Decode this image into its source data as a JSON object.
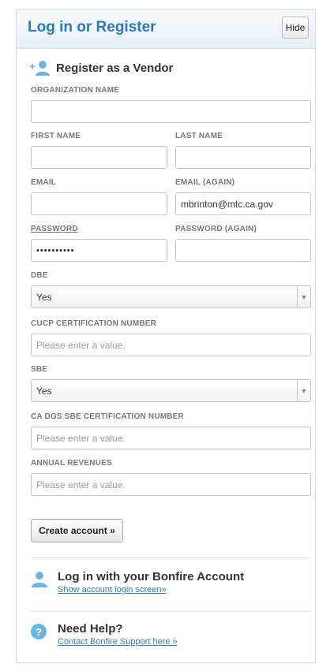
{
  "header": {
    "title": "Log in or Register",
    "hide_label": "Hide"
  },
  "register": {
    "heading": "Register as a Vendor"
  },
  "fields": {
    "org_name": {
      "label": "ORGANIZATION NAME",
      "value": ""
    },
    "first_name": {
      "label": "FIRST NAME",
      "value": ""
    },
    "last_name": {
      "label": "LAST NAME",
      "value": ""
    },
    "email": {
      "label": "EMAIL",
      "value": ""
    },
    "email_again": {
      "label": "EMAIL (AGAIN)",
      "value": "mbrinton@mtc.ca.gov"
    },
    "password": {
      "label": "PASSWORD",
      "value": "••••••••••"
    },
    "password_again": {
      "label": "PASSWORD (AGAIN)",
      "value": ""
    },
    "dbe": {
      "label": "DBE",
      "selected": "Yes"
    },
    "cucp": {
      "label": "CUCP CERTIFICATION NUMBER",
      "placeholder": "Please enter a value."
    },
    "sbe": {
      "label": "SBE",
      "selected": "Yes"
    },
    "ca_dgs": {
      "label": "CA DGS SBE CERTIFICATION NUMBER",
      "placeholder": "Please enter a value."
    },
    "annual_revenues": {
      "label": "ANNUAL REVENUES",
      "placeholder": "Please enter a value."
    }
  },
  "create_button": "Create account »",
  "login": {
    "title": "Log in with your Bonfire Account",
    "link": "Show account login screen»"
  },
  "help": {
    "title": "Need Help?",
    "link": "Contact Bonfire Support here »"
  },
  "icons": {
    "register": "add-user-icon",
    "login": "user-icon",
    "help": "question-icon"
  },
  "colors": {
    "accent": "#2b7ab8",
    "icon": "#6bb5e3"
  }
}
